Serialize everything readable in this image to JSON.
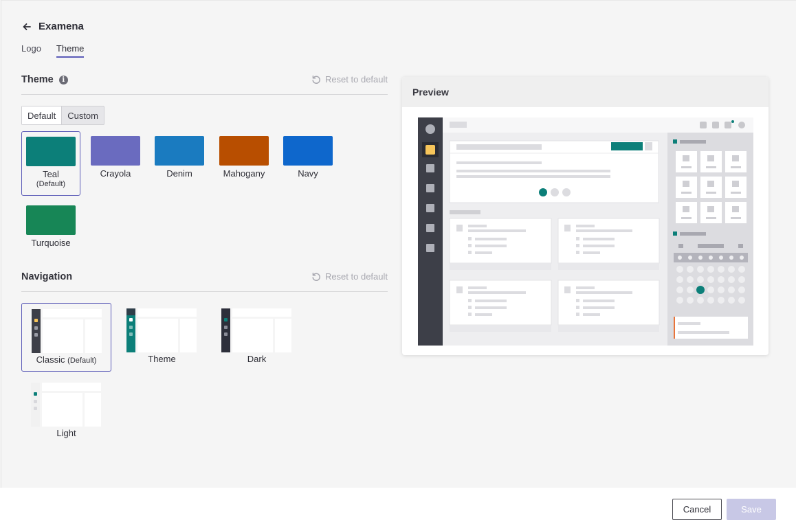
{
  "header": {
    "title": "Examena"
  },
  "tabs": [
    {
      "label": "Logo"
    },
    {
      "label": "Theme"
    }
  ],
  "theme_section": {
    "title": "Theme",
    "reset_label": "Reset to default",
    "modes": [
      {
        "label": "Default"
      },
      {
        "label": "Custom"
      }
    ],
    "swatches": [
      {
        "name": "Teal",
        "sub": "(Default)",
        "color": "#0c7f79"
      },
      {
        "name": "Crayola",
        "color": "#6a6bbf"
      },
      {
        "name": "Denim",
        "color": "#1a7bc0"
      },
      {
        "name": "Mahogany",
        "color": "#b84e00"
      },
      {
        "name": "Navy",
        "color": "#0e67cc"
      },
      {
        "name": "Turquoise",
        "color": "#178656"
      }
    ]
  },
  "navigation_section": {
    "title": "Navigation",
    "reset_label": "Reset to default",
    "options": [
      {
        "name": "Classic",
        "sub": "(Default)"
      },
      {
        "name": "Theme"
      },
      {
        "name": "Dark"
      },
      {
        "name": "Light"
      }
    ]
  },
  "preview": {
    "title": "Preview"
  },
  "footer": {
    "cancel_label": "Cancel",
    "save_label": "Save"
  },
  "colors": {
    "accent": "#5c5cb8",
    "teal": "#0c7f79",
    "dark_nav": "#3d3f48",
    "highlight_yellow": "#f7c55a"
  }
}
